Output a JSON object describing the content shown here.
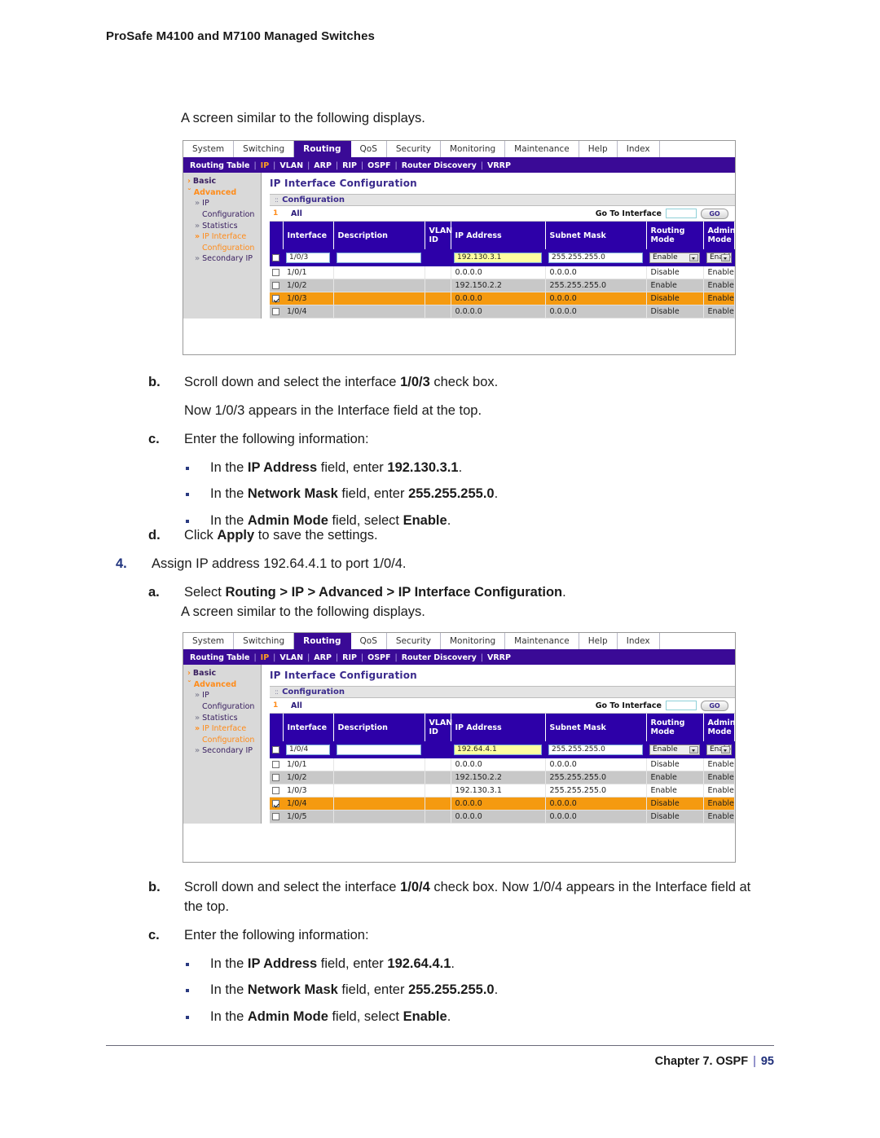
{
  "document": {
    "header": "ProSafe M4100 and M7100 Managed Switches",
    "footer_chapter": "Chapter 7. OSPF",
    "footer_sep": "|",
    "footer_page": "95"
  },
  "lead_text_1": "A screen similar to the following displays.",
  "lead_text_2": "A screen similar to the following displays.",
  "steps_block_1": {
    "b_marker": "b.",
    "b_text_pre": "Scroll down and select the interface ",
    "b_text_bold": "1/0/3",
    "b_text_post": " check box.",
    "b_note": "Now 1/0/3 appears in the Interface field at the top.",
    "c_marker": "c.",
    "c_text": "Enter the following information:",
    "bullets": [
      {
        "pre": "In the ",
        "bold1": "IP Address",
        "mid": " field, enter ",
        "bold2": "192.130.3.1",
        "post": "."
      },
      {
        "pre": "In the ",
        "bold1": "Network Mask",
        "mid": " field, enter ",
        "bold2": "255.255.255.0",
        "post": "."
      },
      {
        "pre": "In the ",
        "bold1": "Admin Mode",
        "mid": " field, select ",
        "bold2": "Enable",
        "post": "."
      }
    ]
  },
  "steps_block_2": {
    "d_marker": "d.",
    "d_pre": "Click ",
    "d_bold": "Apply",
    "d_post": " to save the settings.",
    "four_marker": "4.",
    "four_text": "Assign IP address 192.64.4.1 to port 1/0/4.",
    "a_marker": "a.",
    "a_pre": "Select ",
    "a_bold": "Routing > IP > Advanced > IP Interface Configuration",
    "a_post": "."
  },
  "steps_block_3": {
    "b_marker": "b.",
    "b_text_pre": "Scroll down and select the interface ",
    "b_text_bold": "1/0/4",
    "b_text_post": " check box. Now 1/0/4 appears in the Interface field at the top.",
    "c_marker": "c.",
    "c_text": "Enter the following information:",
    "bullets": [
      {
        "pre": "In the ",
        "bold1": "IP Address",
        "mid": " field, enter ",
        "bold2": "192.64.4.1",
        "post": "."
      },
      {
        "pre": "In the ",
        "bold1": "Network Mask",
        "mid": " field, enter ",
        "bold2": "255.255.255.0",
        "post": "."
      },
      {
        "pre": "In the ",
        "bold1": "Admin Mode",
        "mid": " field, select ",
        "bold2": "Enable",
        "post": "."
      }
    ]
  },
  "colors": {
    "nav_purple": "#3a0a96",
    "table_header_blue": "#2d00a8",
    "selected_row_orange": "#f59a10",
    "alt_row_gray": "#c8c8c8",
    "highlight_field_yellow": "#ffffa0",
    "sidebar_orange": "#ff8c1a"
  },
  "screenshot_1": {
    "tabs": [
      {
        "label": "System",
        "active": false
      },
      {
        "label": "Switching",
        "active": false
      },
      {
        "label": "Routing",
        "active": true
      },
      {
        "label": "QoS",
        "active": false
      },
      {
        "label": "Security",
        "active": false
      },
      {
        "label": "Monitoring",
        "active": false
      },
      {
        "label": "Maintenance",
        "active": false
      },
      {
        "label": "Help",
        "active": false
      },
      {
        "label": "Index",
        "active": false
      }
    ],
    "subnav": [
      {
        "label": "Routing Table",
        "active": false
      },
      {
        "label": "IP",
        "active": true
      },
      {
        "label": "VLAN",
        "active": false
      },
      {
        "label": "ARP",
        "active": false
      },
      {
        "label": "RIP",
        "active": false
      },
      {
        "label": "OSPF",
        "active": false
      },
      {
        "label": "Router Discovery",
        "active": false
      },
      {
        "label": "VRRP",
        "active": false
      }
    ],
    "sidebar": [
      {
        "label": "Basic",
        "level": 0,
        "marker": "›",
        "selected": false
      },
      {
        "label": "Advanced",
        "level": 0,
        "marker": "ˇ",
        "selected": true
      },
      {
        "label": "IP",
        "level": 1,
        "marker": "»",
        "orange": false
      },
      {
        "label": "Configuration",
        "level": 2,
        "marker": "",
        "orange": false
      },
      {
        "label": "Statistics",
        "level": 1,
        "marker": "»",
        "orange": false
      },
      {
        "label": "IP Interface",
        "level": 1,
        "marker": "»",
        "orange": true
      },
      {
        "label": "Configuration",
        "level": 2,
        "marker": "",
        "orange": true
      },
      {
        "label": "Secondary IP",
        "level": 1,
        "marker": "»",
        "orange": false
      }
    ],
    "panel_title": "IP Interface Configuration",
    "section_label": "Configuration",
    "toolrow": {
      "index": "1",
      "all_label": "All",
      "goto_label": "Go To Interface",
      "goto_value": "",
      "go_button": "GO"
    },
    "columns": [
      "",
      "Interface",
      "Description",
      "VLAN ID",
      "IP Address",
      "Subnet Mask",
      "Routing Mode",
      "Administrative Mode"
    ],
    "edit_row": {
      "checked": false,
      "interface": "1/0/3",
      "description": "",
      "vlan_id": "",
      "ip_address": "192.130.3.1",
      "subnet_mask": "255.255.255.0",
      "routing_mode": "Enable",
      "admin_mode": "Enable"
    },
    "rows": [
      {
        "checked": false,
        "interface": "1/0/1",
        "description": "",
        "vlan_id": "",
        "ip_address": "0.0.0.0",
        "subnet_mask": "0.0.0.0",
        "routing_mode": "Disable",
        "admin_mode": "Enable",
        "style": "white"
      },
      {
        "checked": false,
        "interface": "1/0/2",
        "description": "",
        "vlan_id": "",
        "ip_address": "192.150.2.2",
        "subnet_mask": "255.255.255.0",
        "routing_mode": "Enable",
        "admin_mode": "Enable",
        "style": "alt"
      },
      {
        "checked": true,
        "interface": "1/0/3",
        "description": "",
        "vlan_id": "",
        "ip_address": "0.0.0.0",
        "subnet_mask": "0.0.0.0",
        "routing_mode": "Disable",
        "admin_mode": "Enable",
        "style": "sel"
      },
      {
        "checked": false,
        "interface": "1/0/4",
        "description": "",
        "vlan_id": "",
        "ip_address": "0.0.0.0",
        "subnet_mask": "0.0.0.0",
        "routing_mode": "Disable",
        "admin_mode": "Enable",
        "style": "alt"
      }
    ]
  },
  "screenshot_2": {
    "tabs": [
      {
        "label": "System",
        "active": false
      },
      {
        "label": "Switching",
        "active": false
      },
      {
        "label": "Routing",
        "active": true
      },
      {
        "label": "QoS",
        "active": false
      },
      {
        "label": "Security",
        "active": false
      },
      {
        "label": "Monitoring",
        "active": false
      },
      {
        "label": "Maintenance",
        "active": false
      },
      {
        "label": "Help",
        "active": false
      },
      {
        "label": "Index",
        "active": false
      }
    ],
    "subnav": [
      {
        "label": "Routing Table",
        "active": false
      },
      {
        "label": "IP",
        "active": true
      },
      {
        "label": "VLAN",
        "active": false
      },
      {
        "label": "ARP",
        "active": false
      },
      {
        "label": "RIP",
        "active": false
      },
      {
        "label": "OSPF",
        "active": false
      },
      {
        "label": "Router Discovery",
        "active": false
      },
      {
        "label": "VRRP",
        "active": false
      }
    ],
    "sidebar": [
      {
        "label": "Basic",
        "level": 0,
        "marker": "›",
        "selected": false
      },
      {
        "label": "Advanced",
        "level": 0,
        "marker": "ˇ",
        "selected": true
      },
      {
        "label": "IP",
        "level": 1,
        "marker": "»",
        "orange": false
      },
      {
        "label": "Configuration",
        "level": 2,
        "marker": "",
        "orange": false
      },
      {
        "label": "Statistics",
        "level": 1,
        "marker": "»",
        "orange": false
      },
      {
        "label": "IP Interface",
        "level": 1,
        "marker": "»",
        "orange": true
      },
      {
        "label": "Configuration",
        "level": 2,
        "marker": "",
        "orange": true
      },
      {
        "label": "Secondary IP",
        "level": 1,
        "marker": "»",
        "orange": false
      }
    ],
    "panel_title": "IP Interface Configuration",
    "section_label": "Configuration",
    "toolrow": {
      "index": "1",
      "all_label": "All",
      "goto_label": "Go To Interface",
      "goto_value": "",
      "go_button": "GO"
    },
    "columns": [
      "",
      "Interface",
      "Description",
      "VLAN ID",
      "IP Address",
      "Subnet Mask",
      "Routing Mode",
      "Administrative Mode"
    ],
    "edit_row": {
      "checked": false,
      "interface": "1/0/4",
      "description": "",
      "vlan_id": "",
      "ip_address": "192.64.4.1",
      "subnet_mask": "255.255.255.0",
      "routing_mode": "Enable",
      "admin_mode": "Enable"
    },
    "rows": [
      {
        "checked": false,
        "interface": "1/0/1",
        "description": "",
        "vlan_id": "",
        "ip_address": "0.0.0.0",
        "subnet_mask": "0.0.0.0",
        "routing_mode": "Disable",
        "admin_mode": "Enable",
        "style": "white"
      },
      {
        "checked": false,
        "interface": "1/0/2",
        "description": "",
        "vlan_id": "",
        "ip_address": "192.150.2.2",
        "subnet_mask": "255.255.255.0",
        "routing_mode": "Enable",
        "admin_mode": "Enable",
        "style": "alt"
      },
      {
        "checked": false,
        "interface": "1/0/3",
        "description": "",
        "vlan_id": "",
        "ip_address": "192.130.3.1",
        "subnet_mask": "255.255.255.0",
        "routing_mode": "Enable",
        "admin_mode": "Enable",
        "style": "white"
      },
      {
        "checked": true,
        "interface": "1/0/4",
        "description": "",
        "vlan_id": "",
        "ip_address": "0.0.0.0",
        "subnet_mask": "0.0.0.0",
        "routing_mode": "Disable",
        "admin_mode": "Enable",
        "style": "sel"
      },
      {
        "checked": false,
        "interface": "1/0/5",
        "description": "",
        "vlan_id": "",
        "ip_address": "0.0.0.0",
        "subnet_mask": "0.0.0.0",
        "routing_mode": "Disable",
        "admin_mode": "Enable",
        "style": "alt"
      }
    ]
  }
}
